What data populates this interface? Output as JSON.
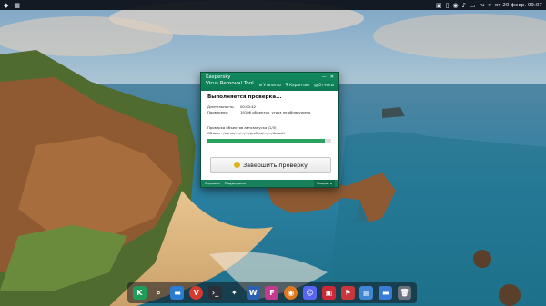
{
  "topbar": {
    "locale": "ru",
    "datetime": "вт 20 февр. 09:07"
  },
  "kaspersky": {
    "brand": "Kaspersky",
    "product": "Virus Removal Tool",
    "nav": [
      "Утилиты",
      "Карантин",
      "Отчеты"
    ],
    "title": "Выполняется проверка...",
    "duration_label": "Длительность:",
    "duration_value": "00:00:42",
    "checked_label": "Проверено:",
    "checked_value": "19106 объектов, угроз не обнаружено",
    "autostart_line": "Проверка объектов автозапуска (1/3)",
    "object_line": "Объект: /home/..../.../.../profiles/.../.../default",
    "progress": 0.95,
    "stop_button": "Завершить проверку",
    "footer_links": [
      "Справка",
      "Поддержка"
    ],
    "exit_button": "Закрыть"
  },
  "dock": {
    "icons": [
      "kaspersky-icon",
      "search-icon",
      "folder-icon",
      "vivaldi-icon",
      "terminal-icon",
      "kdeconnect-icon",
      "word-icon",
      "firefox-icon",
      "blender-icon",
      "discord-icon",
      "save-icon",
      "app-icon",
      "files-icon",
      "folder-icon",
      "trash-icon"
    ]
  }
}
